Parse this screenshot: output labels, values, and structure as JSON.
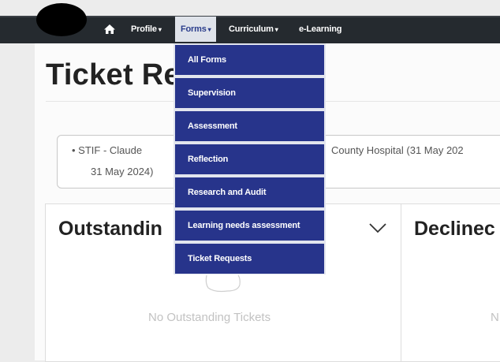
{
  "nav": {
    "items": [
      {
        "label": "Profile",
        "caret": "▾"
      },
      {
        "label": "Forms",
        "caret": "▾"
      },
      {
        "label": "Curriculum",
        "caret": "▾"
      },
      {
        "label": "e-Learning"
      }
    ],
    "home_icon": "home-icon"
  },
  "page": {
    "title": "Ticket Re"
  },
  "info": {
    "line1_left": "•  STIF - Claude",
    "line1_right": "County Hospital (31 May 202",
    "line2": "31 May 2024)"
  },
  "cards": {
    "outstanding": {
      "title": "Outstandin",
      "empty": "No Outstanding Tickets",
      "toggle_icon": "chevron-down-icon"
    },
    "declined": {
      "title": "Declinec",
      "empty": "N"
    }
  },
  "forms_menu": {
    "items": [
      "All Forms",
      "Supervision",
      "Assessment",
      "Reflection",
      "Research and Audit",
      "Learning needs assessment",
      "Ticket Requests"
    ]
  },
  "colors": {
    "navbar": "#252a2f",
    "menu_item": "#27348b",
    "active_tab": "#dfe3ea"
  }
}
